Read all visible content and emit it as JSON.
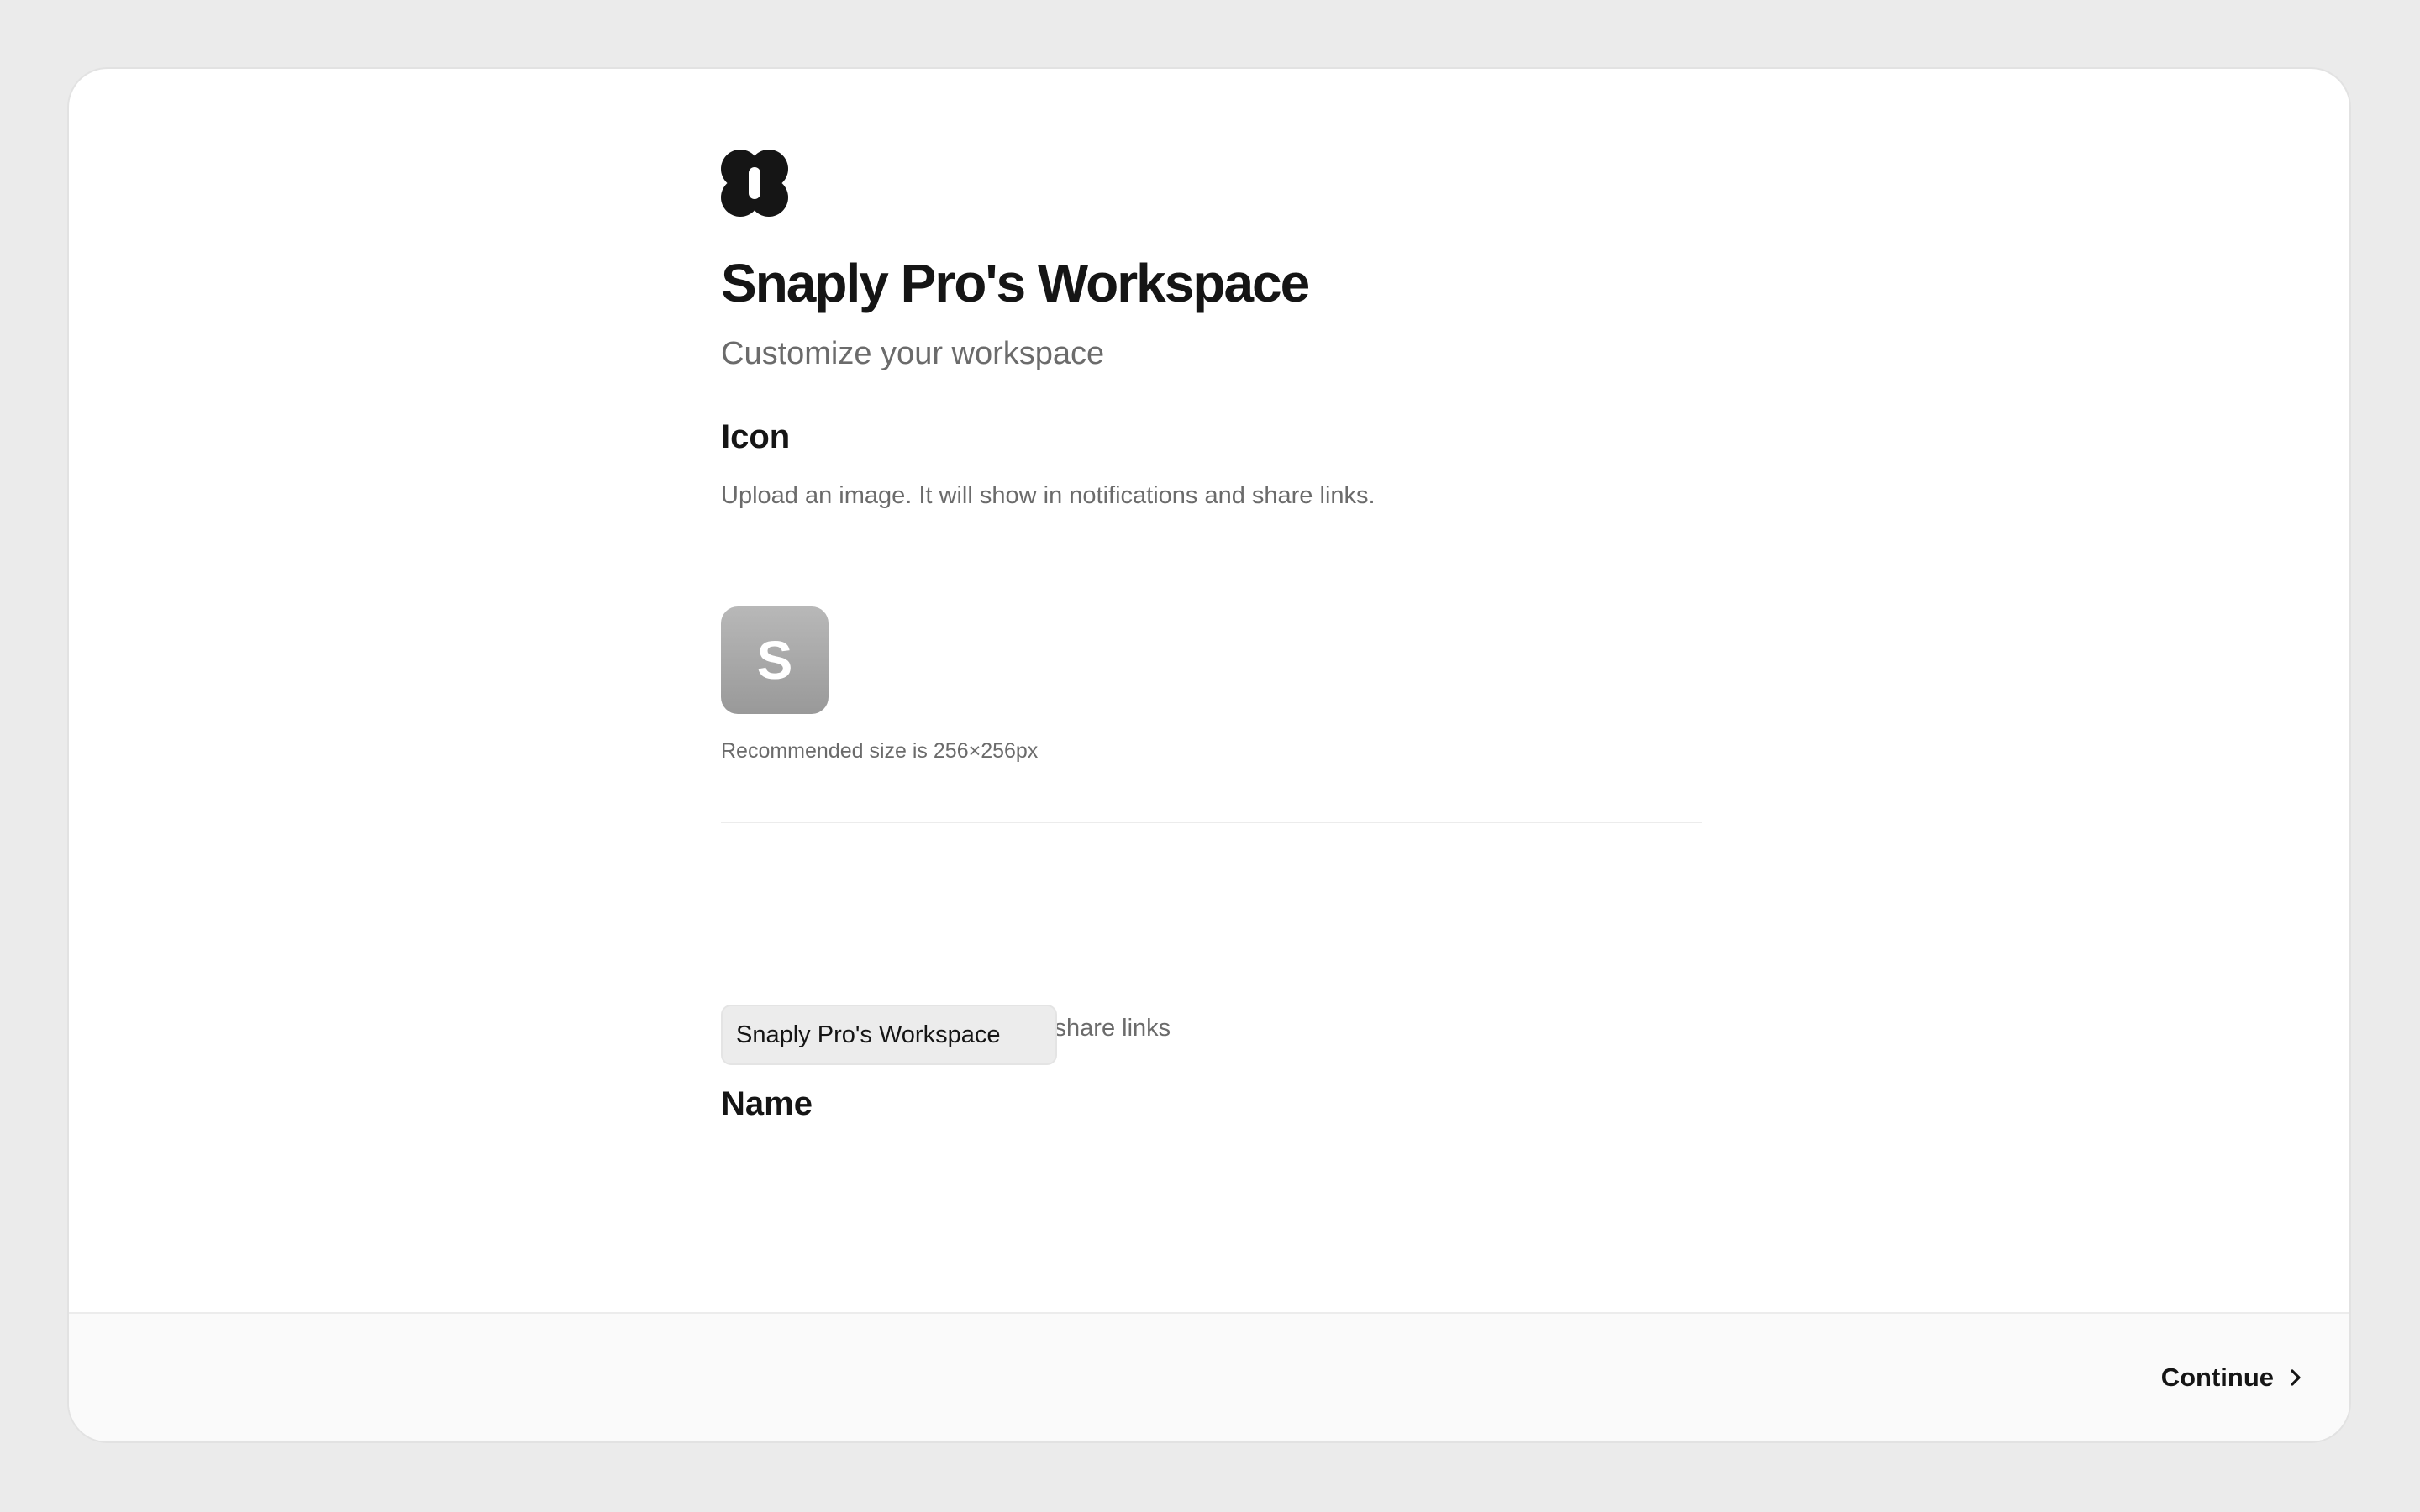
{
  "workspace": {
    "title": "Snaply Pro's Workspace",
    "subtitle": "Customize your workspace"
  },
  "icon_section": {
    "title": "Icon",
    "description": "Upload an image. It will show in notifications and share links.",
    "avatar_letter": "S",
    "hint": "Recommended size is 256×256px"
  },
  "name_section": {
    "title": "Name",
    "description": "It will show in notifications and share links",
    "input_value": "Snaply Pro's Workspace"
  },
  "footer": {
    "continue_label": "Continue"
  },
  "icons": {
    "logo": "app-logo-icon",
    "continue": "chevron-right-icon"
  },
  "colors": {
    "background": "#ebebeb",
    "card": "#ffffff",
    "text": "#151515",
    "muted": "#6b6b6b",
    "avatar": "#a9a9a9"
  }
}
